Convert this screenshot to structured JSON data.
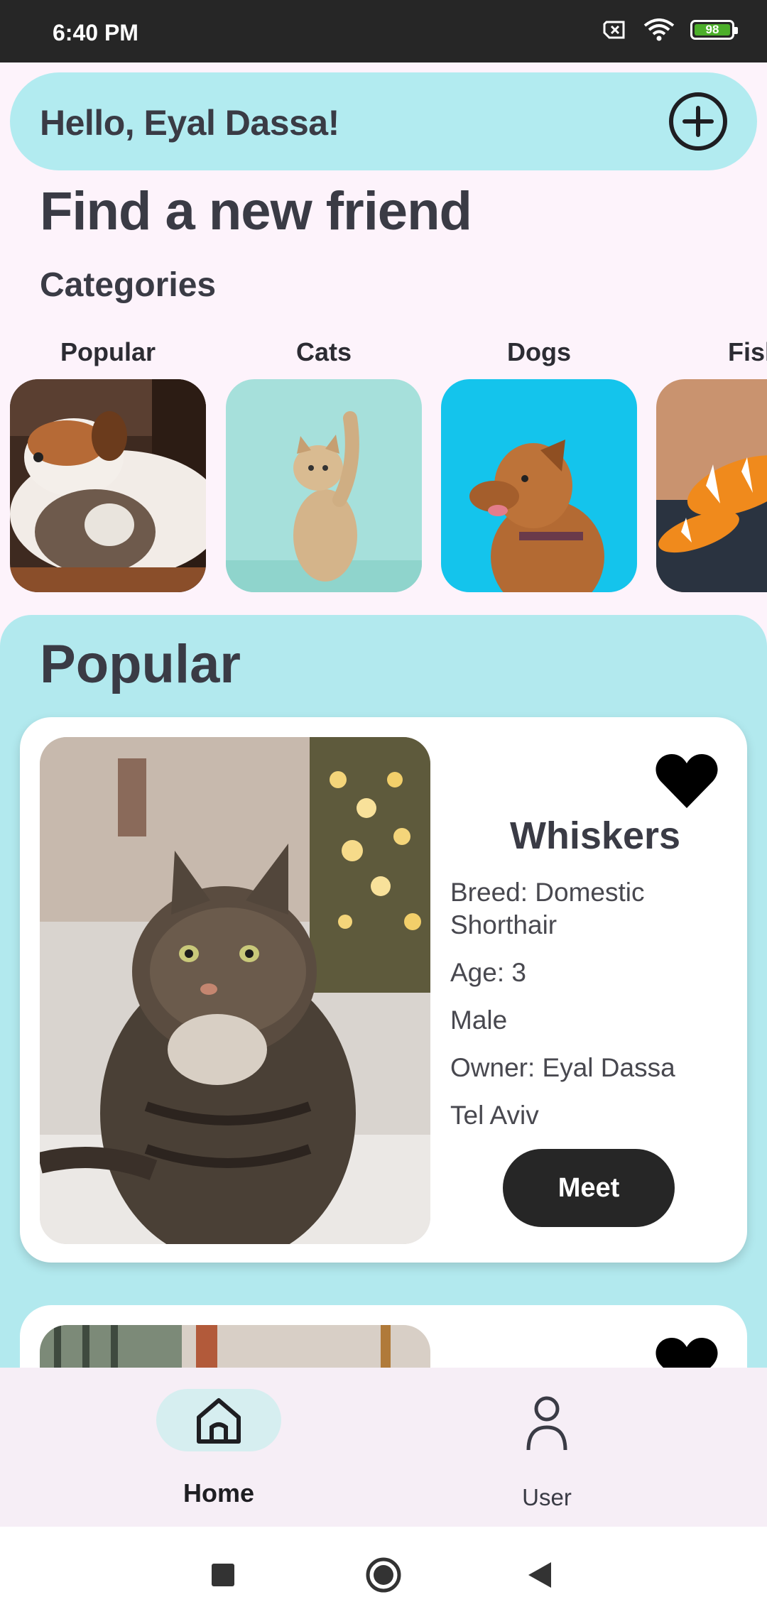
{
  "status_bar": {
    "time": "6:40 PM",
    "battery": "98"
  },
  "header": {
    "greeting": "Hello, Eyal Dassa!"
  },
  "title": "Find a new friend",
  "categories": {
    "heading": "Categories",
    "items": [
      {
        "label": "Popular"
      },
      {
        "label": "Cats"
      },
      {
        "label": "Dogs"
      },
      {
        "label": "Fish"
      }
    ]
  },
  "popular": {
    "heading": "Popular",
    "pets": [
      {
        "name": "Whiskers",
        "breed": "Breed: Domestic Shorthair",
        "age": "Age: 3",
        "gender": "Male",
        "owner": "Owner: Eyal Dassa",
        "location": "Tel Aviv",
        "button": "Meet"
      }
    ]
  },
  "bottom_nav": {
    "home": "Home",
    "user": "User"
  },
  "colors": {
    "accent": "#b2ebf0",
    "background": "#fdf3fb",
    "button": "#262626"
  }
}
